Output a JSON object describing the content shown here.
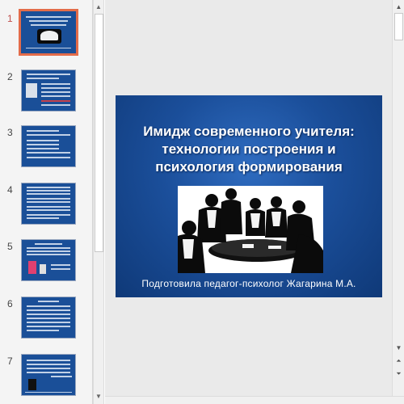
{
  "thumbnails": [
    {
      "number": "1"
    },
    {
      "number": "2"
    },
    {
      "number": "3"
    },
    {
      "number": "4"
    },
    {
      "number": "5"
    },
    {
      "number": "6"
    },
    {
      "number": "7"
    }
  ],
  "slide": {
    "title_line1": "Имидж современного учителя:",
    "title_line2": "технологии построения и",
    "title_line3": "психология формирования",
    "subtitle": "Подготовила педагог-психолог Жагарина М.А."
  },
  "scroll_icons": {
    "up": "scroll-up-arrow",
    "down": "scroll-down-arrow",
    "prev_slide": "previous-slide",
    "next_slide": "next-slide"
  },
  "colors": {
    "slide_background": "#1b4f9b",
    "active_thumbnail_border": "#e36c4a",
    "active_number": "#c0504d"
  }
}
